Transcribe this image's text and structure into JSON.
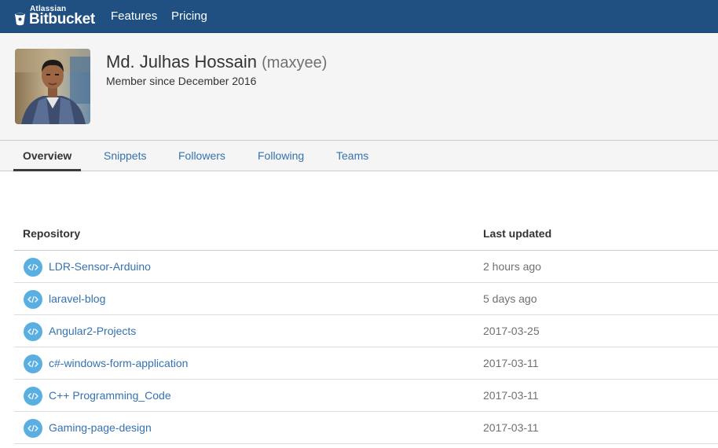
{
  "header": {
    "brand_super": "Atlassian",
    "brand": "Bitbucket",
    "nav": [
      {
        "label": "Features"
      },
      {
        "label": "Pricing"
      }
    ]
  },
  "profile": {
    "display_name": "Md. Julhas Hossain",
    "username": "(maxyee)",
    "member_since": "Member since December 2016"
  },
  "tabs": [
    {
      "label": "Overview",
      "active": true
    },
    {
      "label": "Snippets"
    },
    {
      "label": "Followers"
    },
    {
      "label": "Following"
    },
    {
      "label": "Teams"
    }
  ],
  "repos": {
    "columns": {
      "repository": "Repository",
      "last_updated": "Last updated"
    },
    "rows": [
      {
        "name": "LDR-Sensor-Arduino",
        "updated": "2 hours ago"
      },
      {
        "name": "laravel-blog",
        "updated": "5 days ago"
      },
      {
        "name": "Angular2-Projects",
        "updated": "2017-03-25"
      },
      {
        "name": "c#-windows-form-application",
        "updated": "2017-03-11"
      },
      {
        "name": "C++ Programming_Code",
        "updated": "2017-03-11"
      },
      {
        "name": "Gaming-page-design",
        "updated": "2017-03-11"
      }
    ]
  },
  "colors": {
    "topbar": "#205081",
    "link": "#3572b0",
    "repo_icon": "#59afe1"
  },
  "icons": {
    "logo": "bitbucket-bucket-icon",
    "repo": "code-icon"
  }
}
